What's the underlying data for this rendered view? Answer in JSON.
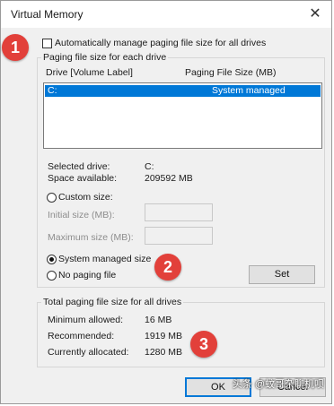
{
  "window": {
    "title": "Virtual Memory",
    "close_glyph": "✕"
  },
  "auto_manage": {
    "label": "Automatically manage paging file size for all drives",
    "checked": false
  },
  "paging_group": {
    "title": "Paging file size for each drive",
    "col_drive": "Drive  [Volume Label]",
    "col_size": "Paging File Size (MB)",
    "rows": [
      {
        "drive": "C:",
        "size": "System managed",
        "selected": true
      }
    ]
  },
  "selected_drive": {
    "label": "Selected drive:",
    "value": "C:"
  },
  "space_available": {
    "label": "Space available:",
    "value": "209592 MB"
  },
  "options": {
    "custom": "Custom size:",
    "initial": "Initial size (MB):",
    "maximum": "Maximum size (MB):",
    "system": "System managed size",
    "none": "No paging file",
    "selected": "System managed size",
    "set_button": "Set"
  },
  "total_group": {
    "title": "Total paging file size for all drives",
    "min_label": "Minimum allowed:",
    "min_value": "16 MB",
    "rec_label": "Recommended:",
    "rec_value": "1919 MB",
    "cur_label": "Currently allocated:",
    "cur_value": "1280 MB"
  },
  "buttons": {
    "ok": "OK",
    "cancel": "Cancel"
  },
  "markers": [
    "1",
    "2",
    "3"
  ],
  "watermark": "头条 @蚊哥杂聊机呗",
  "colors": {
    "selection": "#0078d7",
    "marker": "#e2403a",
    "default_button_border": "#0078d7"
  }
}
